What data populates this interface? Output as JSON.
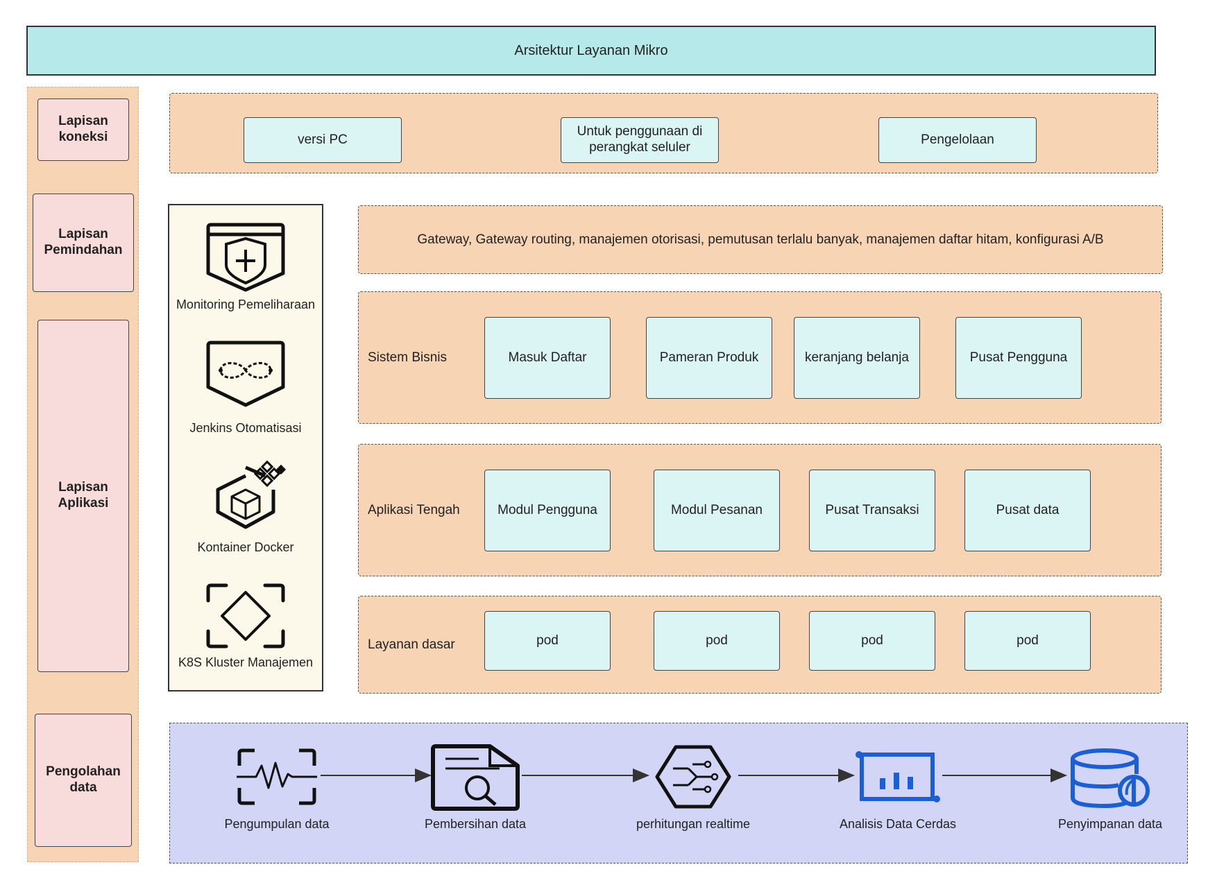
{
  "title": "Arsitektur Layanan Mikro",
  "layers": {
    "connection": "Lapisan koneksi",
    "transfer": "Lapisan Pemindahan",
    "application": "Lapisan Aplikasi",
    "data_processing": "Pengolahan data"
  },
  "connection_items": [
    "versi PC",
    "Untuk penggunaan di perangkat seluler",
    "Pengelolaan"
  ],
  "gateway_text": "Gateway, Gateway routing, manajemen otorisasi, pemutusan terlalu banyak, manajemen daftar hitam, konfigurasi A/B",
  "business": {
    "label": "Sistem Bisnis",
    "items": [
      "Masuk Daftar",
      "Pameran Produk",
      "keranjang belanja",
      "Pusat Pengguna"
    ]
  },
  "middle": {
    "label": "Aplikasi Tengah",
    "items": [
      "Modul Pengguna",
      "Modul Pesanan",
      "Pusat Transaksi",
      "Pusat data"
    ]
  },
  "base": {
    "label": "Layanan dasar",
    "items": [
      "pod",
      "pod",
      "pod",
      "pod"
    ]
  },
  "devops": [
    {
      "label": "Monitoring Pemeliharaan",
      "icon": "shield-plus-icon"
    },
    {
      "label": "Jenkins Otomatisasi",
      "icon": "infinity-loop-icon"
    },
    {
      "label": "Kontainer Docker",
      "icon": "docker-cube-icon"
    },
    {
      "label": "K8S Kluster Manajemen",
      "icon": "k8s-diamond-icon"
    }
  ],
  "pipeline": [
    {
      "label": "Pengumpulan data",
      "icon": "pulse-scan-icon"
    },
    {
      "label": "Pembersihan data",
      "icon": "document-search-icon"
    },
    {
      "label": "perhitungan realtime",
      "icon": "circuit-hexagon-icon"
    },
    {
      "label": "Analisis Data Cerdas",
      "icon": "bar-chart-icon"
    },
    {
      "label": "Penyimpanan data",
      "icon": "database-icon"
    }
  ],
  "colors": {
    "title_bg": "#b6e9ea",
    "layer_bg": "#f7d5b4",
    "cyan_box": "#dbf4f4",
    "label_pink": "#f8dbdb",
    "devops_bg": "#fcf8ea",
    "data_bg": "#d3d5f7",
    "accent_blue": "#1a5fd6"
  }
}
